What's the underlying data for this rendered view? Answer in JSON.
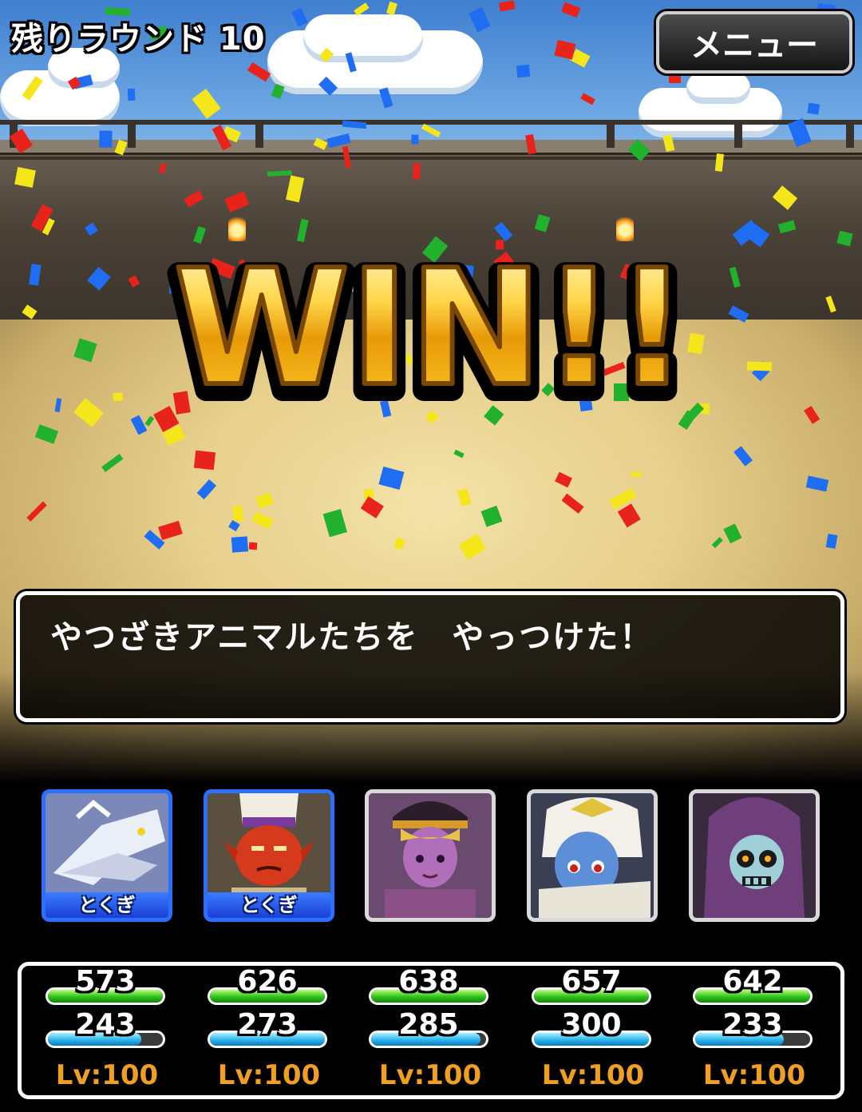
{
  "hud": {
    "rounds_label": "残りラウンド 10",
    "menu_label": "メニュー"
  },
  "banner": {
    "text": "WIN!!"
  },
  "message": {
    "text": "やつざきアニマルたちを　やっつけた！"
  },
  "party": [
    {
      "tag": "とくぎ",
      "special": true,
      "hp": "573",
      "mp": "243",
      "hp_fill": 1.0,
      "mp_fill": 0.81,
      "level": "Lv:100",
      "icon": "white-dragon-icon"
    },
    {
      "tag": "とくぎ",
      "special": true,
      "hp": "626",
      "mp": "273",
      "hp_fill": 1.0,
      "mp_fill": 1.0,
      "level": "Lv:100",
      "icon": "red-demon-priest-icon"
    },
    {
      "tag": "",
      "special": false,
      "hp": "638",
      "mp": "285",
      "hp_fill": 1.0,
      "mp_fill": 0.95,
      "level": "Lv:100",
      "icon": "purple-dancer-icon"
    },
    {
      "tag": "",
      "special": false,
      "hp": "657",
      "mp": "300",
      "hp_fill": 1.0,
      "mp_fill": 1.0,
      "level": "Lv:100",
      "icon": "blue-ice-girl-icon"
    },
    {
      "tag": "",
      "special": false,
      "hp": "642",
      "mp": "233",
      "hp_fill": 1.0,
      "mp_fill": 0.77,
      "level": "Lv:100",
      "icon": "skull-sorcerer-icon"
    }
  ]
}
